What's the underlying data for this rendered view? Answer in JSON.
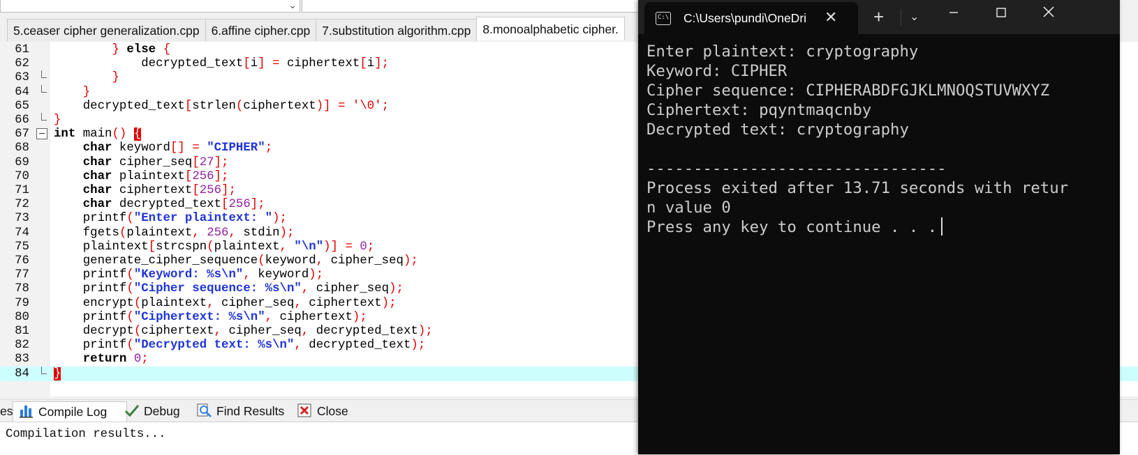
{
  "ide": {
    "tabs": [
      {
        "label": "5.ceaser cipher generalization.cpp",
        "active": false
      },
      {
        "label": "6.affine cipher.cpp",
        "active": false
      },
      {
        "label": "7.substitution algorithm.cpp",
        "active": false
      },
      {
        "label": "8.monoalphabetic cipher.",
        "active": true
      }
    ],
    "code_lines": [
      {
        "n": "61",
        "html": "        <span class='br'>}</span> <span class='kw'>else</span> <span class='br'>{</span>"
      },
      {
        "n": "62",
        "html": "            decrypted_text<span class='op'>[</span>i<span class='op'>]</span> <span class='op'>=</span> ciphertext<span class='op'>[</span>i<span class='op'>];</span>"
      },
      {
        "n": "63",
        "html": "        <span class='br'>}</span>"
      },
      {
        "n": "64",
        "html": "    <span class='br'>}</span>"
      },
      {
        "n": "65",
        "html": "    decrypted_text<span class='op'>[</span>strlen<span class='op'>(</span>ciphertext<span class='op'>)]</span> <span class='op'>=</span> <span class='op'>'\\0';</span>"
      },
      {
        "n": "66",
        "html": "<span class='br'>}</span>"
      },
      {
        "n": "67",
        "html": "<span class='kw'>int</span> main<span class='op'>()</span> <span class='brh'>{</span>"
      },
      {
        "n": "68",
        "html": "    <span class='kw'>char</span> keyword<span class='op'>[]</span> <span class='op'>=</span> <span class='str'>\"CIPHER\"</span><span class='op'>;</span>"
      },
      {
        "n": "69",
        "html": "    <span class='kw'>char</span> cipher_seq<span class='op'>[</span><span class='num'>27</span><span class='op'>];</span>"
      },
      {
        "n": "70",
        "html": "    <span class='kw'>char</span> plaintext<span class='op'>[</span><span class='num'>256</span><span class='op'>];</span>"
      },
      {
        "n": "71",
        "html": "    <span class='kw'>char</span> ciphertext<span class='op'>[</span><span class='num'>256</span><span class='op'>];</span>"
      },
      {
        "n": "72",
        "html": "    <span class='kw'>char</span> decrypted_text<span class='op'>[</span><span class='num'>256</span><span class='op'>];</span>"
      },
      {
        "n": "73",
        "html": "    printf<span class='op'>(</span><span class='str'>\"Enter plaintext: \"</span><span class='op'>);</span>"
      },
      {
        "n": "74",
        "html": "    fgets<span class='op'>(</span>plaintext<span class='op'>,</span> <span class='num'>256</span><span class='op'>,</span> stdin<span class='op'>);</span>"
      },
      {
        "n": "75",
        "html": "    plaintext<span class='op'>[</span>strcspn<span class='op'>(</span>plaintext<span class='op'>,</span> <span class='str'>\"\\n\"</span><span class='op'>)]</span> <span class='op'>=</span> <span class='num'>0</span><span class='op'>;</span>"
      },
      {
        "n": "76",
        "html": "    generate_cipher_sequence<span class='op'>(</span>keyword<span class='op'>,</span> cipher_seq<span class='op'>);</span>"
      },
      {
        "n": "77",
        "html": "    printf<span class='op'>(</span><span class='str'>\"Keyword: %s\\n\"</span><span class='op'>,</span> keyword<span class='op'>);</span>"
      },
      {
        "n": "78",
        "html": "    printf<span class='op'>(</span><span class='str'>\"Cipher sequence: %s\\n\"</span><span class='op'>,</span> cipher_seq<span class='op'>);</span>"
      },
      {
        "n": "79",
        "html": "    encrypt<span class='op'>(</span>plaintext<span class='op'>,</span> cipher_seq<span class='op'>,</span> ciphertext<span class='op'>);</span>"
      },
      {
        "n": "80",
        "html": "    printf<span class='op'>(</span><span class='str'>\"Ciphertext: %s\\n\"</span><span class='op'>,</span> ciphertext<span class='op'>);</span>"
      },
      {
        "n": "81",
        "html": "    decrypt<span class='op'>(</span>ciphertext<span class='op'>,</span> cipher_seq<span class='op'>,</span> decrypted_text<span class='op'>);</span>"
      },
      {
        "n": "82",
        "html": "    printf<span class='op'>(</span><span class='str'>\"Decrypted text: %s\\n\"</span><span class='op'>,</span> decrypted_text<span class='op'>);</span>"
      },
      {
        "n": "83",
        "html": "    <span class='kw'>return</span> <span class='num'>0</span><span class='op'>;</span>"
      },
      {
        "n": "84",
        "html": "<span class='brh'>}</span>"
      }
    ],
    "bottom_tabs": {
      "partial": "es",
      "compile_log": "Compile Log",
      "debug": "Debug",
      "find_results": "Find Results",
      "close": "Close"
    },
    "log_text": "Compilation results..."
  },
  "console": {
    "tab_title": "C:\\Users\\pundi\\OneDri",
    "lines": [
      "Enter plaintext: cryptography",
      "Keyword: CIPHER",
      "Cipher sequence: CIPHERABDFGJKLMNOQSTUVWXYZ",
      "Ciphertext: pqyntmaqcnby",
      "Decrypted text: cryptography",
      "",
      "--------------------------------",
      "Process exited after 13.71 seconds with retur",
      "n value 0",
      "Press any key to continue . . ."
    ]
  },
  "colors": {
    "current_line": "#cdfefe",
    "brace_match": "#e00000",
    "console_bg": "#0c0c0c"
  }
}
